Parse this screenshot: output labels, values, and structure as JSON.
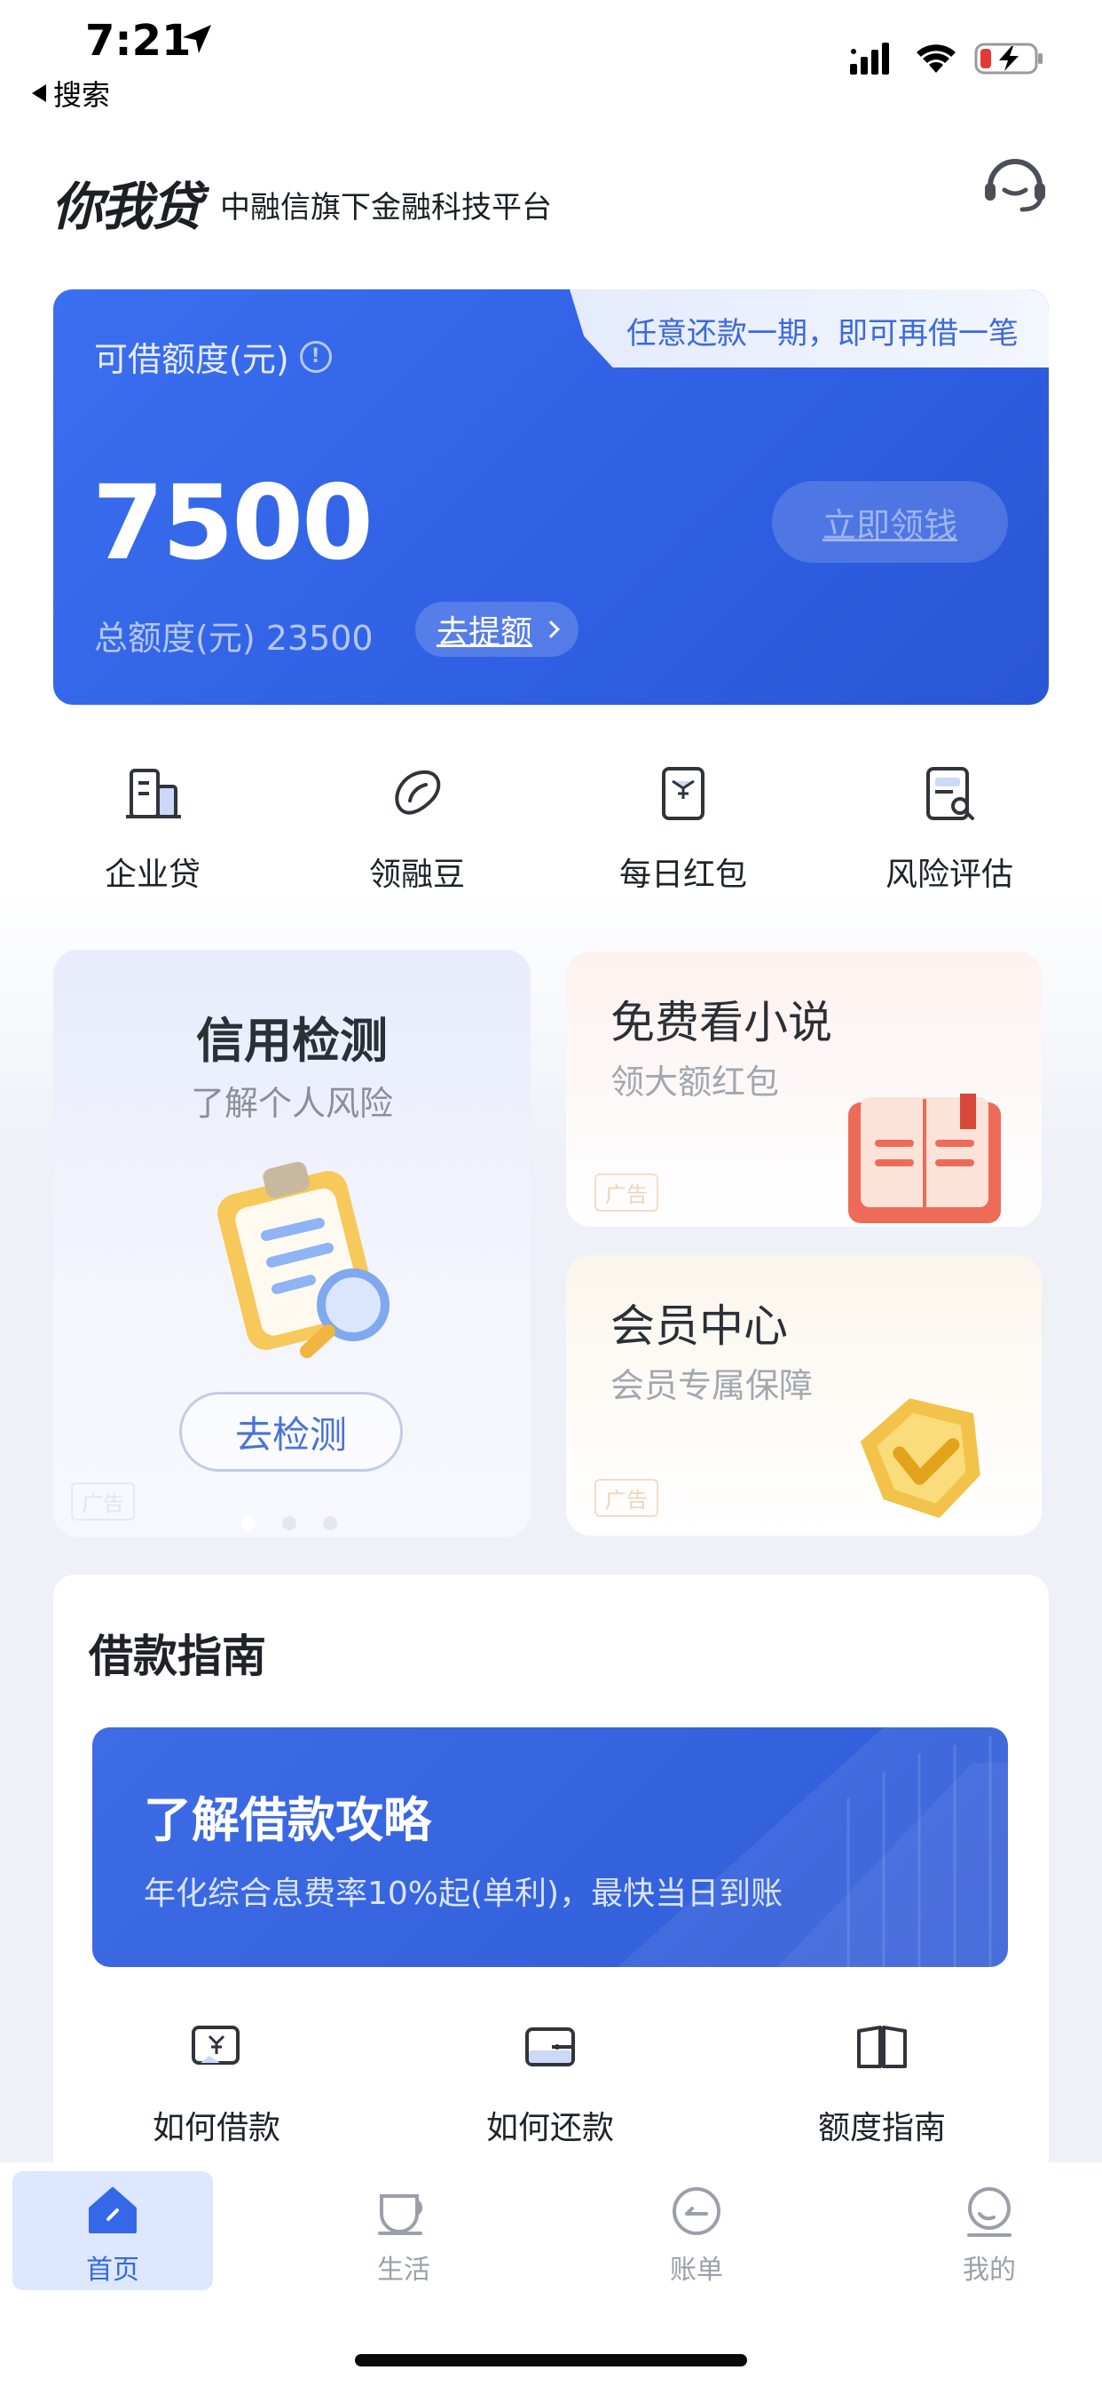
{
  "status_bar": {
    "time": "7:21",
    "back_label": "搜索"
  },
  "header": {
    "brand": "你我贷",
    "tagline": "中融信旗下金融科技平台",
    "support_icon": "headset-icon"
  },
  "credit_card": {
    "promo": "任意还款一期，即可再借一笔",
    "limit_label": "可借额度(元)",
    "limit_amount": "7500",
    "claim_button": "立即领钱",
    "total_label": "总额度(元) 23500",
    "raise_button": "去提额",
    "colors": {
      "card": "#2f5fe2",
      "promo_text": "#3c68e0"
    }
  },
  "quick_actions": [
    {
      "label": "企业贷",
      "icon": "building-icon"
    },
    {
      "label": "领融豆",
      "icon": "bean-icon"
    },
    {
      "label": "每日红包",
      "icon": "red-envelope-icon"
    },
    {
      "label": "风险评估",
      "icon": "document-search-icon"
    }
  ],
  "promo_cards": {
    "credit_check": {
      "title": "信用检测",
      "subtitle": "了解个人风险",
      "button": "去检测",
      "ad": "广告"
    },
    "novel": {
      "title": "免费看小说",
      "subtitle": "领大额红包",
      "ad": "广告"
    },
    "vip": {
      "title": "会员中心",
      "subtitle": "会员专属保障",
      "ad": "广告"
    }
  },
  "guide": {
    "title": "借款指南",
    "banner_title": "了解借款攻略",
    "banner_subtitle": "年化综合息费率10%起(单利)，最快当日到账",
    "items": [
      {
        "label": "如何借款",
        "icon": "money-card-icon"
      },
      {
        "label": "如何还款",
        "icon": "wallet-icon"
      },
      {
        "label": "额度指南",
        "icon": "book-info-icon"
      }
    ]
  },
  "tabbar": {
    "tabs": [
      {
        "label": "首页",
        "icon": "home-icon",
        "active": true
      },
      {
        "label": "生活",
        "icon": "cup-icon",
        "active": false
      },
      {
        "label": "账单",
        "icon": "bill-icon",
        "active": false
      },
      {
        "label": "我的",
        "icon": "profile-icon",
        "active": false
      }
    ],
    "colors": {
      "active": "#3468e6",
      "inactive": "#9aa0aa"
    }
  }
}
